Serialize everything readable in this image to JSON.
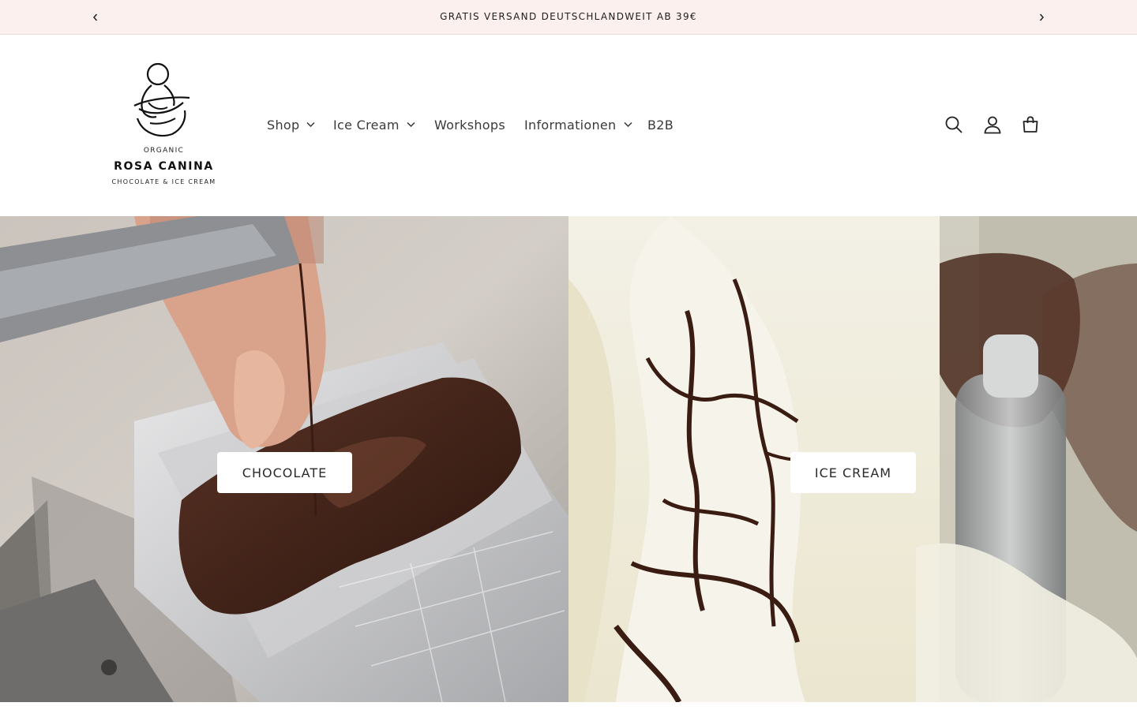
{
  "announcement": {
    "text": "GRATIS VERSAND DEUTSCHLANDWEIT AB 39€",
    "prev_icon": "chevron-left-icon",
    "next_icon": "chevron-right-icon"
  },
  "logo": {
    "top_text": "ORGANIC",
    "brand": "ROSA CANINA",
    "sub_text": "CHOCOLATE & ICE CREAM"
  },
  "nav": {
    "items": [
      {
        "label": "Shop",
        "has_dropdown": true
      },
      {
        "label": "Ice Cream",
        "has_dropdown": true
      },
      {
        "label": "Workshops",
        "has_dropdown": false
      },
      {
        "label": "Informationen",
        "has_dropdown": true
      },
      {
        "label": "B2B",
        "has_dropdown": false
      }
    ]
  },
  "header_icons": [
    "search-icon",
    "account-icon",
    "cart-icon"
  ],
  "hero": {
    "left_button": "CHOCOLATE",
    "right_button": "ICE CREAM"
  },
  "colors": {
    "announcement_bg": "#fbf0ed",
    "text": "#1f1f1f",
    "chocolate": "#3b1f15",
    "cream": "#f1eede"
  }
}
